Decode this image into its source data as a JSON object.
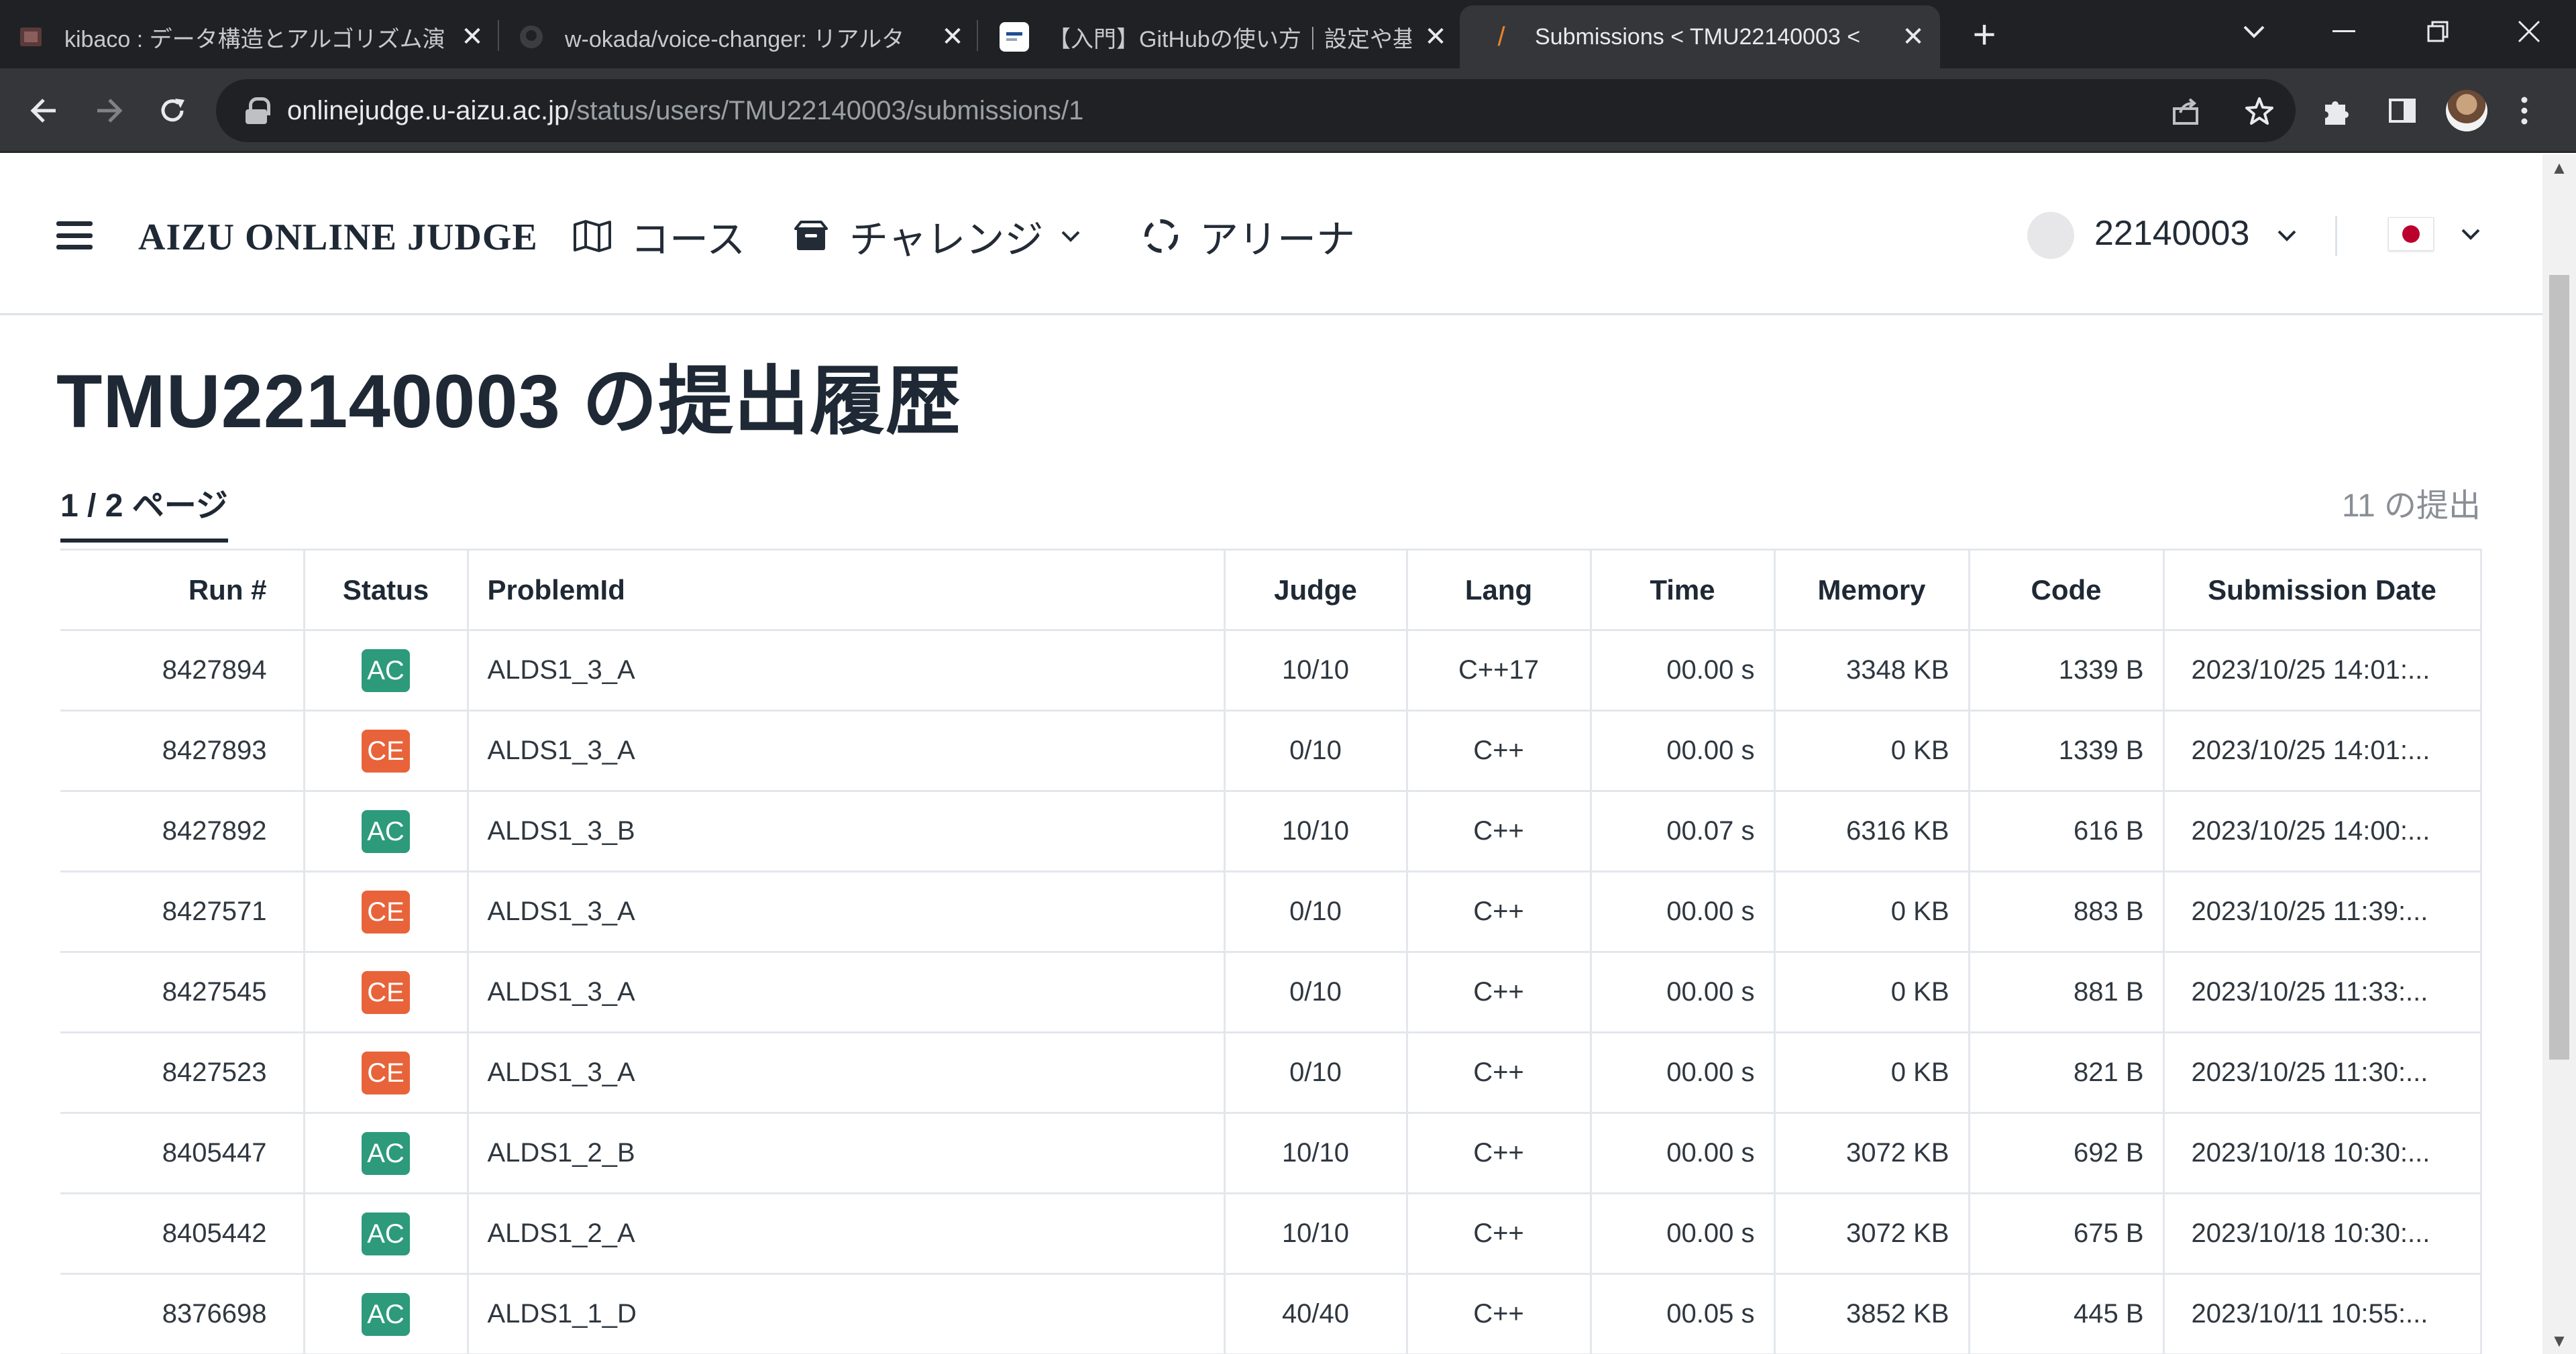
{
  "browser": {
    "tabs": [
      {
        "title": "kibaco : データ構造とアルゴリズム演",
        "active": false
      },
      {
        "title": "w-okada/voice-changer: リアルタ",
        "active": false
      },
      {
        "title": "【入門】GitHubの使い方｜設定や基",
        "active": false
      },
      {
        "title": "Submissions < TMU22140003 <",
        "active": true
      }
    ],
    "url_host": "onlinejudge.u-aizu.ac.jp",
    "url_path": "/status/users/TMU22140003/submissions/1"
  },
  "header": {
    "brand": "AIZU ONLINE JUDGE",
    "nav": {
      "course": "コース",
      "challenge": "チャレンジ",
      "arena": "アリーナ"
    },
    "user": "22140003"
  },
  "main": {
    "title": "TMU22140003 の提出履歴",
    "pager": "1 / 2 ページ",
    "count": "11 の提出",
    "columns": [
      "Run #",
      "Status",
      "ProblemId",
      "Judge",
      "Lang",
      "Time",
      "Memory",
      "Code",
      "Submission Date"
    ],
    "rows": [
      {
        "run": "8427894",
        "status": "AC",
        "problem": "ALDS1_3_A",
        "judge": "10/10",
        "lang": "C++17",
        "time": "00.00 s",
        "memory": "3348 KB",
        "code": "1339 B",
        "date": "2023/10/25 14:01:..."
      },
      {
        "run": "8427893",
        "status": "CE",
        "problem": "ALDS1_3_A",
        "judge": "0/10",
        "lang": "C++",
        "time": "00.00 s",
        "memory": "0 KB",
        "code": "1339 B",
        "date": "2023/10/25 14:01:..."
      },
      {
        "run": "8427892",
        "status": "AC",
        "problem": "ALDS1_3_B",
        "judge": "10/10",
        "lang": "C++",
        "time": "00.07 s",
        "memory": "6316 KB",
        "code": "616 B",
        "date": "2023/10/25 14:00:..."
      },
      {
        "run": "8427571",
        "status": "CE",
        "problem": "ALDS1_3_A",
        "judge": "0/10",
        "lang": "C++",
        "time": "00.00 s",
        "memory": "0 KB",
        "code": "883 B",
        "date": "2023/10/25 11:39:..."
      },
      {
        "run": "8427545",
        "status": "CE",
        "problem": "ALDS1_3_A",
        "judge": "0/10",
        "lang": "C++",
        "time": "00.00 s",
        "memory": "0 KB",
        "code": "881 B",
        "date": "2023/10/25 11:33:..."
      },
      {
        "run": "8427523",
        "status": "CE",
        "problem": "ALDS1_3_A",
        "judge": "0/10",
        "lang": "C++",
        "time": "00.00 s",
        "memory": "0 KB",
        "code": "821 B",
        "date": "2023/10/25 11:30:..."
      },
      {
        "run": "8405447",
        "status": "AC",
        "problem": "ALDS1_2_B",
        "judge": "10/10",
        "lang": "C++",
        "time": "00.00 s",
        "memory": "3072 KB",
        "code": "692 B",
        "date": "2023/10/18 10:30:..."
      },
      {
        "run": "8405442",
        "status": "AC",
        "problem": "ALDS1_2_A",
        "judge": "10/10",
        "lang": "C++",
        "time": "00.00 s",
        "memory": "3072 KB",
        "code": "675 B",
        "date": "2023/10/18 10:30:..."
      },
      {
        "run": "8376698",
        "status": "AC",
        "problem": "ALDS1_1_D",
        "judge": "40/40",
        "lang": "C++",
        "time": "00.05 s",
        "memory": "3852 KB",
        "code": "445 B",
        "date": "2023/10/11 10:55:..."
      }
    ]
  },
  "colors": {
    "ac": "#2d9a7b",
    "ce": "#e8633a",
    "chrome_dark": "#202124",
    "chrome_toolbar": "#35363a"
  },
  "icons": {
    "course": "book-open-icon",
    "challenge": "box-icon",
    "arena": "dashed-circle-icon",
    "locale": "japan-flag-icon"
  }
}
